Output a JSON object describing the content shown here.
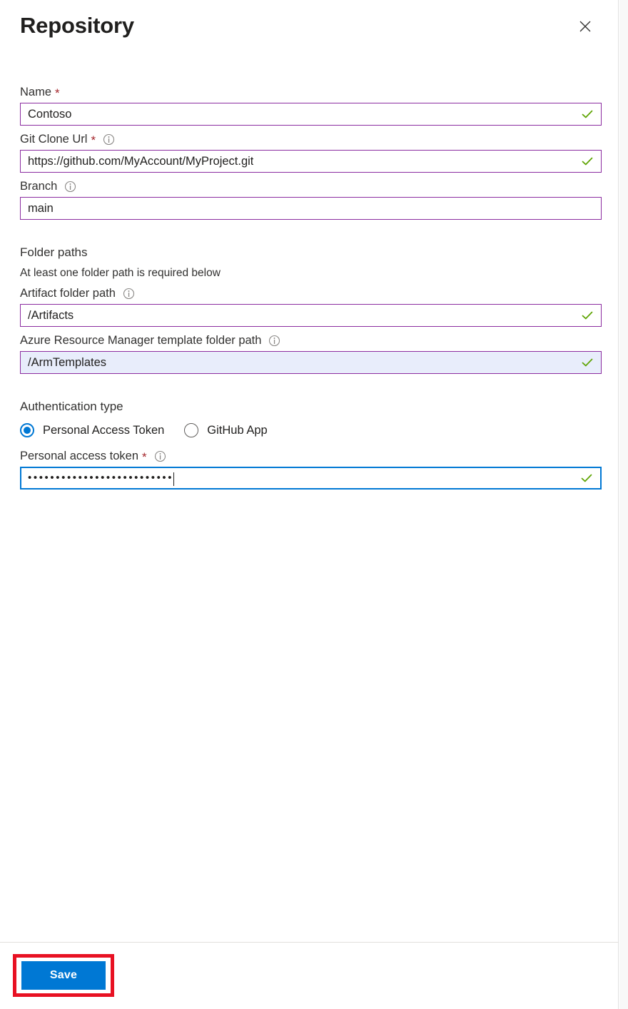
{
  "panel": {
    "title": "Repository",
    "close_icon": "close-icon"
  },
  "fields": {
    "name": {
      "label": "Name",
      "required_marker": "*",
      "value": "Contoso",
      "valid_icon": "checkmark-icon"
    },
    "git_clone_url": {
      "label": "Git Clone Url",
      "required_marker": "*",
      "info_icon": "info-icon",
      "value": "https://github.com/MyAccount/MyProject.git",
      "valid_icon": "checkmark-icon"
    },
    "branch": {
      "label": "Branch",
      "info_icon": "info-icon",
      "value": "main"
    }
  },
  "folder_paths": {
    "heading": "Folder paths",
    "note": "At least one folder path is required below",
    "artifact": {
      "label": "Artifact folder path",
      "info_icon": "info-icon",
      "value": "/Artifacts",
      "valid_icon": "checkmark-icon"
    },
    "arm_template": {
      "label": "Azure Resource Manager template folder path",
      "info_icon": "info-icon",
      "value": "/ArmTemplates",
      "valid_icon": "checkmark-icon"
    }
  },
  "authentication": {
    "heading": "Authentication type",
    "options": [
      {
        "label": "Personal Access Token",
        "selected": true
      },
      {
        "label": "GitHub App",
        "selected": false
      }
    ],
    "token": {
      "label": "Personal access token",
      "required_marker": "*",
      "info_icon": "info-icon",
      "masked_value": "••••••••••••••••••••••••••",
      "valid_icon": "checkmark-icon"
    }
  },
  "footer": {
    "save_label": "Save"
  },
  "colors": {
    "accent_blue": "#0078d4",
    "field_border_purple": "#8b2ca0",
    "valid_green": "#5da300",
    "required_red": "#a4262c",
    "highlight_red": "#e81123",
    "field_highlight_bg": "#e8edfb"
  }
}
